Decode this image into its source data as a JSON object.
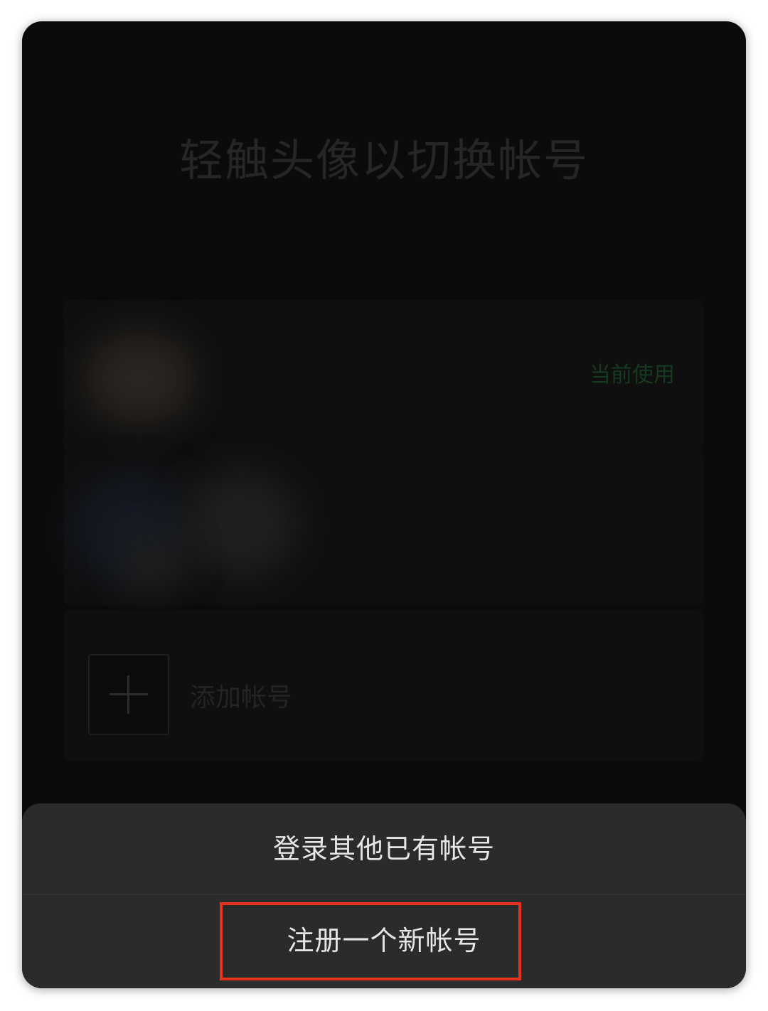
{
  "screen": {
    "title": "轻触头像以切换帐号"
  },
  "accounts": {
    "current_badge": "当前使用",
    "add_label": "添加帐号"
  },
  "action_sheet": {
    "login_existing": "登录其他已有帐号",
    "register_new": "注册一个新帐号"
  },
  "colors": {
    "highlight": "#e5331e",
    "sheet_bg": "#2b2b2b",
    "screen_bg": "#0b0b0b"
  }
}
